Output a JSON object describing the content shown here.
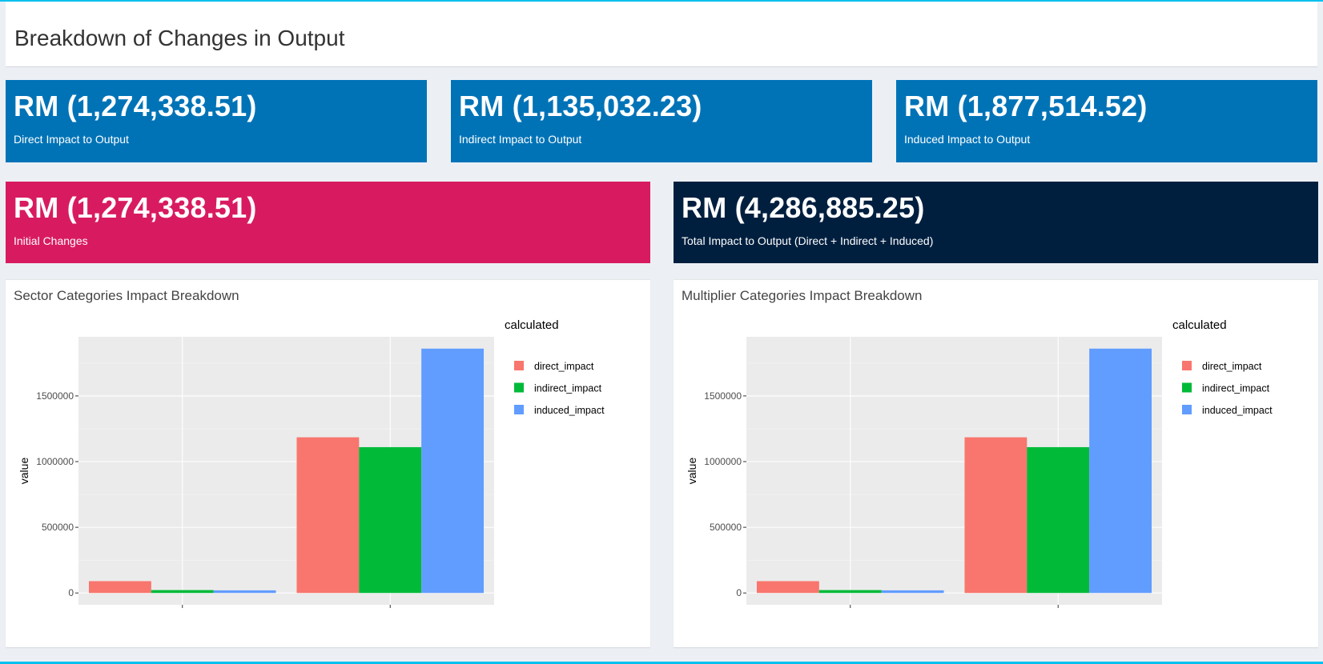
{
  "page": {
    "title": "Breakdown of Changes in Output"
  },
  "value_boxes": {
    "direct": {
      "value": "RM (1,274,338.51)",
      "label": "Direct Impact to Output",
      "color": "#0073b7"
    },
    "indirect": {
      "value": "RM (1,135,032.23)",
      "label": "Indirect Impact to Output",
      "color": "#0073b7"
    },
    "induced": {
      "value": "RM (1,877,514.52)",
      "label": "Induced Impact to Output",
      "color": "#0073b7"
    },
    "initial": {
      "value": "RM (1,274,338.51)",
      "label": "Initial Changes",
      "color": "#d81b60"
    },
    "total": {
      "value": "RM (4,286,885.25)",
      "label": "Total Impact to Output (Direct + Indirect + Induced)",
      "color": "#001f3f"
    }
  },
  "panels": {
    "sector": {
      "title": "Sector Categories Impact Breakdown"
    },
    "multiplier": {
      "title": "Multiplier Categories Impact Breakdown"
    }
  },
  "chart_data": [
    {
      "type": "bar",
      "title": "",
      "xlabel": "",
      "ylabel": "value",
      "legend_title": "calculated",
      "legend_position": "right",
      "grid": true,
      "categories": [
        "",
        ""
      ],
      "ylim": [
        -90000,
        1950000
      ],
      "yticks": [
        0,
        500000,
        1000000,
        1500000
      ],
      "ytick_labels": [
        "0",
        "500000",
        "1000000",
        "1500000"
      ],
      "series": [
        {
          "name": "direct_impact",
          "color": "#F8766D",
          "values": [
            90000,
            1185000
          ]
        },
        {
          "name": "indirect_impact",
          "color": "#00BA38",
          "values": [
            22000,
            1110000
          ]
        },
        {
          "name": "induced_impact",
          "color": "#619CFF",
          "values": [
            20000,
            1860000
          ]
        }
      ]
    },
    {
      "type": "bar",
      "title": "",
      "xlabel": "",
      "ylabel": "value",
      "legend_title": "calculated",
      "legend_position": "right",
      "grid": true,
      "categories": [
        "",
        ""
      ],
      "ylim": [
        -90000,
        1950000
      ],
      "yticks": [
        0,
        500000,
        1000000,
        1500000
      ],
      "ytick_labels": [
        "0",
        "500000",
        "1000000",
        "1500000"
      ],
      "series": [
        {
          "name": "direct_impact",
          "color": "#F8766D",
          "values": [
            90000,
            1185000
          ]
        },
        {
          "name": "indirect_impact",
          "color": "#00BA38",
          "values": [
            22000,
            1110000
          ]
        },
        {
          "name": "induced_impact",
          "color": "#619CFF",
          "values": [
            20000,
            1860000
          ]
        }
      ]
    }
  ]
}
